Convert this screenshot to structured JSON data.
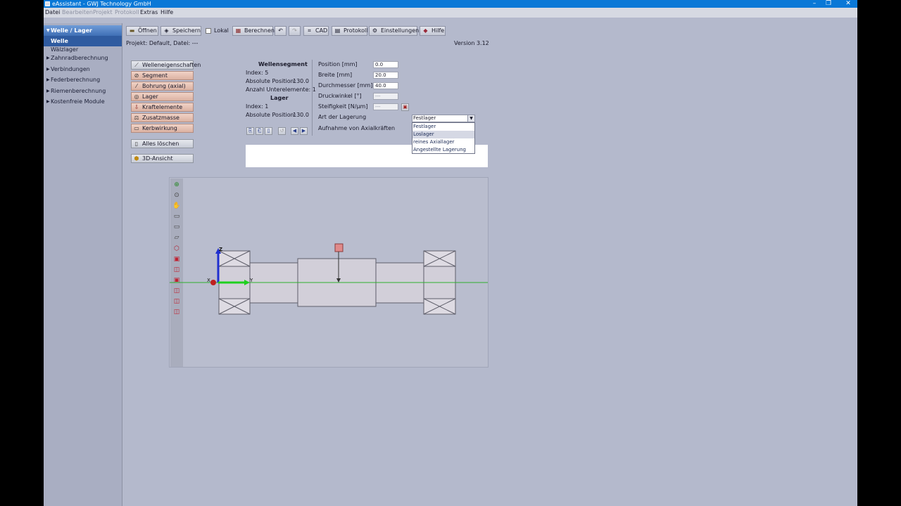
{
  "window": {
    "title": "eAssistant - GWJ Technology GmbH",
    "controls": [
      "–",
      "❐",
      "✕"
    ]
  },
  "menu": {
    "items": [
      "Datei",
      "Bearbeiten",
      "Projekt",
      "Protokoll",
      "Extras",
      "Hilfe"
    ]
  },
  "nav": {
    "header": "Welle / Lager",
    "selected": "Welle",
    "sub": "Wälzlager",
    "items": [
      "Zahnradberechnung",
      "Verbindungen",
      "Federberechnung",
      "Riemenberechnung",
      "Kostenfreie Module"
    ]
  },
  "toolbar": {
    "open": "Öffnen",
    "save": "Speichern",
    "local": "Lokal",
    "calc": "Berechnen",
    "cad": "CAD",
    "protocol": "Protokoll",
    "settings": "Einstellungen",
    "help": "Hilfe"
  },
  "status": {
    "project": "Projekt: Default, Datei: ---",
    "version": "Version 3.12"
  },
  "segments": {
    "buttons": [
      "Welleneigenschaften",
      "Segment",
      "Bohrung (axial)",
      "Lager",
      "Kraftelemente",
      "Zusatzmasse",
      "Kerbwirkung"
    ],
    "clear_all": "Alles löschen",
    "view3d": "3D-Ansicht"
  },
  "info": {
    "segment_title": "Wellensegment",
    "segment_index": "Index: 5",
    "abs_pos_label": "Absolute Position:",
    "abs_pos_value": "130.0",
    "sub_count": "Anzahl Unterelemente: 1",
    "bearing_title": "Lager",
    "bearing_index": "Index: 1",
    "bearing_abs_label": "Absolute Position:",
    "bearing_abs_value": "130.0"
  },
  "fields": {
    "position_label": "Position [mm]",
    "position_value": "0.0",
    "width_label": "Breite [mm]",
    "width_value": "20.0",
    "diameter_label": "Durchmesser [mm]",
    "diameter_value": "40.0",
    "pressure_label": "Druckwinkel [°]",
    "pressure_value": "---",
    "stiffness_label": "Steifigkeit [N/µm]",
    "stiffness_value": "---",
    "bearing_type_label": "Art der Lagerung",
    "axial_label": "Aufnahme von Axialkräften"
  },
  "dropdown": {
    "selected": "Festlager",
    "options": [
      "Festlager",
      "Loslager",
      "reines Axiallager",
      "Angestellte Lagerung"
    ],
    "highlighted_index": 1
  },
  "drawing": {
    "axis_z": "Z",
    "axis_y": "Y",
    "axis_x": "X"
  },
  "colors": {
    "titlebar": "#0a78d7",
    "nav_header": "#3f6fb5",
    "segment_btn": "#e8c3b5"
  }
}
